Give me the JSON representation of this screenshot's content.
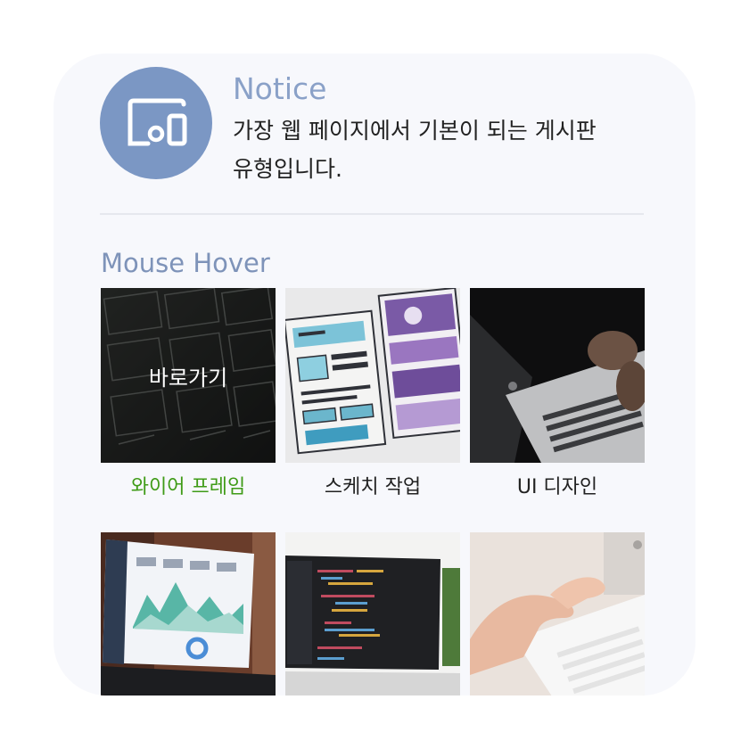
{
  "notice": {
    "title": "Notice",
    "description_line1": "가장 웹 페이지에서 기본이 되는 게시판",
    "description_line2": "유형입니다.",
    "icon": "devices-icon",
    "icon_bg": "#7b97c4"
  },
  "hover_section": {
    "title": "Mouse Hover",
    "hover_label": "바로가기",
    "active_color": "#3f9b17",
    "tiles": [
      {
        "caption": "와이어 프레임",
        "image": "wireframe-sketch-image"
      },
      {
        "caption": "스케치 작업",
        "image": "watercolor-sketch-image"
      },
      {
        "caption": "UI 디자인",
        "image": "laptop-typing-image"
      },
      {
        "caption": "",
        "image": "dashboard-laptop-image"
      },
      {
        "caption": "",
        "image": "code-editor-laptop-image"
      },
      {
        "caption": "",
        "image": "keyboard-typing-image"
      }
    ]
  }
}
